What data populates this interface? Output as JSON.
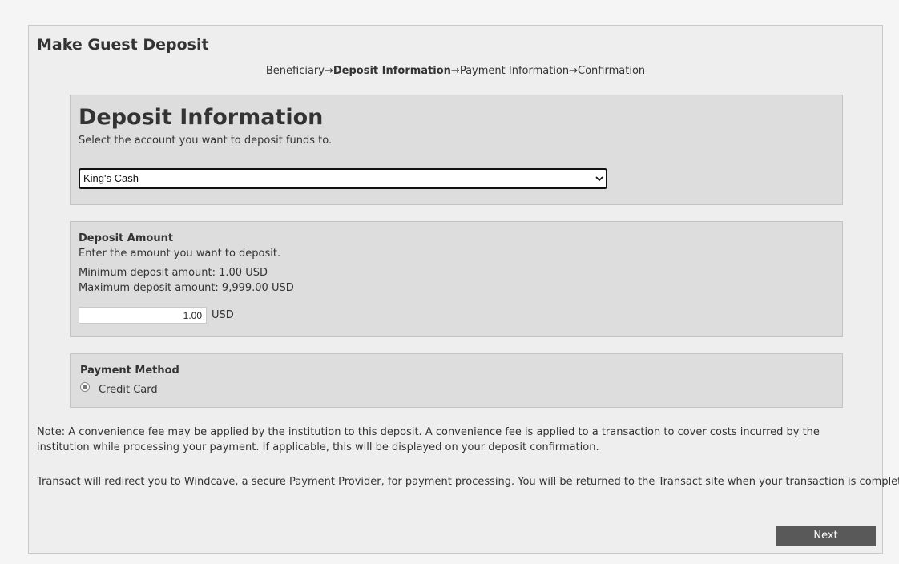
{
  "page": {
    "title": "Make Guest Deposit"
  },
  "steps": {
    "step1": "Beneficiary",
    "step2": "Deposit Information",
    "step3": "Payment Information",
    "step4": "Confirmation",
    "arrow": "→",
    "current_step": "Deposit Information"
  },
  "deposit_info": {
    "heading": "Deposit Information",
    "subtitle": "Select the account you want to deposit funds to.",
    "account_selected": "King's Cash"
  },
  "deposit_amount": {
    "title": "Deposit Amount",
    "subtitle": "Enter the amount you want to deposit.",
    "minimum": "Minimum deposit amount: 1.00 USD",
    "maximum": "Maximum deposit amount: 9,999.00 USD",
    "value": "1.00",
    "currency": "USD"
  },
  "payment_method": {
    "title": "Payment Method",
    "option_label": "Credit Card",
    "selected": true
  },
  "note": "Note: A convenience fee may be applied by the institution to this deposit. A convenience fee is applied to a transaction to cover costs incurred by the institution while processing your payment. If applicable, this will be displayed on your deposit confirmation.",
  "redirect_notice": "Transact will redirect you to Windcave, a secure Payment Provider, for payment processing. You will be returned to the Transact site when your transaction is completed.",
  "buttons": {
    "next_label": "Next"
  },
  "icons": {
    "select_chevron": "chevron-down-icon",
    "radio": "radio-selected-icon"
  }
}
